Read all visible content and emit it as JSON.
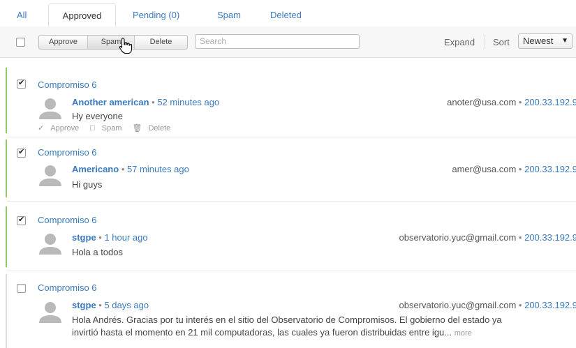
{
  "tabs": [
    {
      "label": "All"
    },
    {
      "label": "Approved"
    },
    {
      "label": "Pending (0)"
    },
    {
      "label": "Spam"
    },
    {
      "label": "Deleted"
    }
  ],
  "toolbar": {
    "approve_label": "Approve",
    "spam_label": "Spam",
    "delete_label": "Delete",
    "search_placeholder": "Search",
    "expand_label": "Expand",
    "sort_label": "Sort",
    "sort_value": "Newest"
  },
  "comments": [
    {
      "thread": "Compromiso 6",
      "author": "Another american",
      "time": "52 minutes ago",
      "email": "anoter@usa.com",
      "ip": "200.33.192.9",
      "body": "Hy everyone",
      "checked": true,
      "actions": {
        "approve": "Approve",
        "spam": "Spam",
        "delete": "Delete"
      }
    },
    {
      "thread": "Compromiso 6",
      "author": "Americano",
      "time": "57 minutes ago",
      "email": "amer@usa.com",
      "ip": "200.33.192.9",
      "body": "Hi guys",
      "checked": true
    },
    {
      "thread": "Compromiso 6",
      "author": "stgpe",
      "time": "1 hour ago",
      "email": "observatorio.yuc@gmail.com",
      "ip": "200.33.192.9",
      "body": "Hola a todos",
      "checked": true
    },
    {
      "thread": "Compromiso 6",
      "author": "stgpe",
      "time": "5 days ago",
      "email": "observatorio.yuc@gmail.com",
      "ip": "200.33.192.9",
      "body_line1": "Hola Andrés. Gracias por tu interés en el sitio del Observatorio de Compromisos. El gobierno del estado ya",
      "body_line2": "invirtió hasta el momento en 21 mil computadoras, las cuales ya fueron distribuidas entre igu...",
      "more": "more",
      "checked": false
    }
  ],
  "colors": {
    "link": "#3a7bbf",
    "approved_bar": "#8fc96a"
  }
}
